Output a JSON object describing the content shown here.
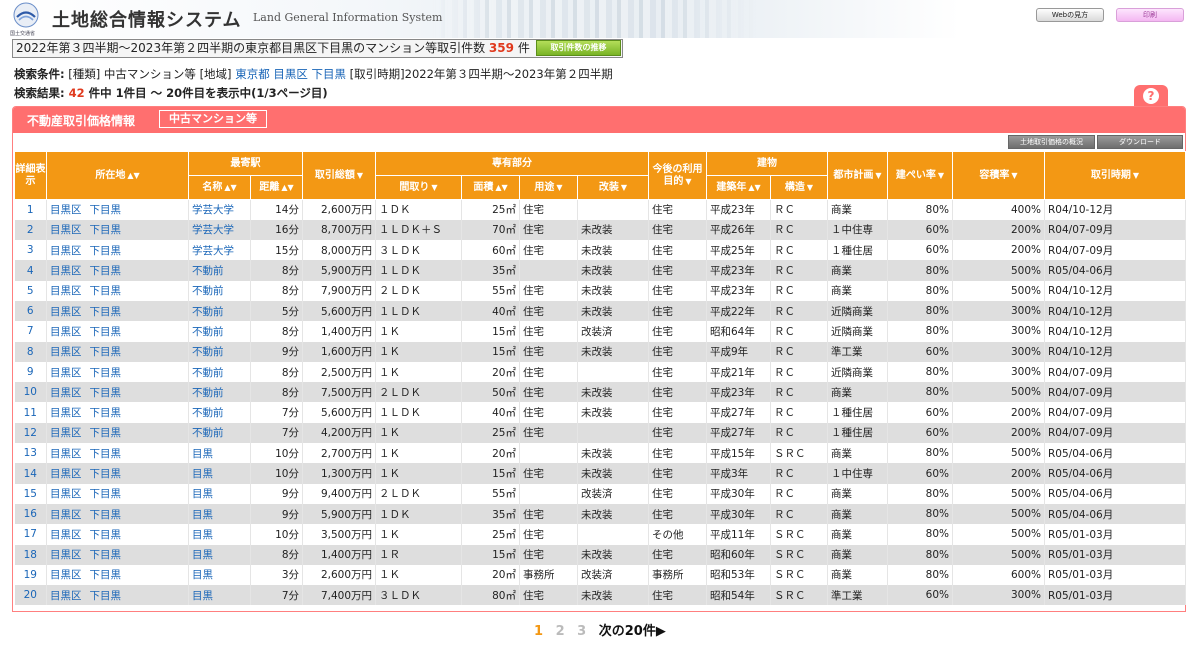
{
  "header": {
    "org": "国土交通省",
    "title": "土地総合情報システム",
    "subtitle": "Land General Information System",
    "web_btn": "Webの見方",
    "print_btn": "印刷"
  },
  "summary": {
    "prefix": "2022年第３四半期〜2023年第２四半期の東京都目黒区下目黒のマンション等取引件数",
    "count": "359",
    "suffix": "件",
    "trend_btn": "取引件数の推移"
  },
  "conditions": {
    "label": "検索条件:",
    "type_label": "[種類]",
    "type_value": "中古マンション等",
    "area_label": "[地域]",
    "pref": "東京都",
    "city": "目黒区",
    "town": "下目黒",
    "period_label": "[取引時期]",
    "period_value": "2022年第３四半期〜2023年第２四半期"
  },
  "results": {
    "label": "検索結果:",
    "count": "42",
    "text": "件中 1件目 〜 20件目を表示中(1/3ページ目)"
  },
  "panel": {
    "title": "不動産取引価格情報",
    "tag": "中古マンション等",
    "overview_btn": "土地取引価格の概況",
    "download_btn": "ダウンロード",
    "help_icon": "?"
  },
  "columns": {
    "detail": "詳細表示",
    "location": "所在地",
    "station": "最寄駅",
    "station_name": "名称",
    "distance": "距離",
    "total_price": "取引総額",
    "private_area": "専有部分",
    "layout": "間取り",
    "area": "面積",
    "use": "用途",
    "renovation": "改装",
    "future_use": "今後の利用目的",
    "building": "建物",
    "built_year": "建築年",
    "structure": "構造",
    "city_plan": "都市計画",
    "coverage": "建ぺい率",
    "floor_ratio": "容積率",
    "period": "取引時期",
    "circumstances": "取引の事情等"
  },
  "rows": [
    {
      "no": "1",
      "loc1": "目黒区",
      "loc2": "下目黒",
      "st": "学芸大学",
      "dist": "14分",
      "price": "2,600万円",
      "layout": "１ＤＫ",
      "area": "25㎡",
      "use": "住宅",
      "reno": "",
      "future": "住宅",
      "built": "平成23年",
      "struct": "ＲＣ",
      "plan": "商業",
      "cov": "80%",
      "far": "400%",
      "period": "R04/10-12月",
      "note": ""
    },
    {
      "no": "2",
      "loc1": "目黒区",
      "loc2": "下目黒",
      "st": "学芸大学",
      "dist": "16分",
      "price": "8,700万円",
      "layout": "１ＬＤＫ＋Ｓ",
      "area": "70㎡",
      "use": "住宅",
      "reno": "未改装",
      "future": "住宅",
      "built": "平成26年",
      "struct": "ＲＣ",
      "plan": "１中住専",
      "cov": "60%",
      "far": "200%",
      "period": "R04/07-09月",
      "note": ""
    },
    {
      "no": "3",
      "loc1": "目黒区",
      "loc2": "下目黒",
      "st": "学芸大学",
      "dist": "15分",
      "price": "8,000万円",
      "layout": "３ＬＤＫ",
      "area": "60㎡",
      "use": "住宅",
      "reno": "未改装",
      "future": "住宅",
      "built": "平成25年",
      "struct": "ＲＣ",
      "plan": "１種住居",
      "cov": "60%",
      "far": "200%",
      "period": "R04/07-09月",
      "note": ""
    },
    {
      "no": "4",
      "loc1": "目黒区",
      "loc2": "下目黒",
      "st": "不動前",
      "dist": "8分",
      "price": "5,900万円",
      "layout": "１ＬＤＫ",
      "area": "35㎡",
      "use": "",
      "reno": "未改装",
      "future": "住宅",
      "built": "平成23年",
      "struct": "ＲＣ",
      "plan": "商業",
      "cov": "80%",
      "far": "500%",
      "period": "R05/04-06月",
      "note": ""
    },
    {
      "no": "5",
      "loc1": "目黒区",
      "loc2": "下目黒",
      "st": "不動前",
      "dist": "8分",
      "price": "7,900万円",
      "layout": "２ＬＤＫ",
      "area": "55㎡",
      "use": "住宅",
      "reno": "未改装",
      "future": "住宅",
      "built": "平成23年",
      "struct": "ＲＣ",
      "plan": "商業",
      "cov": "80%",
      "far": "500%",
      "period": "R04/10-12月",
      "note": ""
    },
    {
      "no": "6",
      "loc1": "目黒区",
      "loc2": "下目黒",
      "st": "不動前",
      "dist": "5分",
      "price": "5,600万円",
      "layout": "１ＬＤＫ",
      "area": "40㎡",
      "use": "住宅",
      "reno": "未改装",
      "future": "住宅",
      "built": "平成22年",
      "struct": "ＲＣ",
      "plan": "近隣商業",
      "cov": "80%",
      "far": "300%",
      "period": "R04/10-12月",
      "note": ""
    },
    {
      "no": "7",
      "loc1": "目黒区",
      "loc2": "下目黒",
      "st": "不動前",
      "dist": "8分",
      "price": "1,400万円",
      "layout": "１Ｋ",
      "area": "15㎡",
      "use": "住宅",
      "reno": "改装済",
      "future": "住宅",
      "built": "昭和64年",
      "struct": "ＲＣ",
      "plan": "近隣商業",
      "cov": "80%",
      "far": "300%",
      "period": "R04/10-12月",
      "note": ""
    },
    {
      "no": "8",
      "loc1": "目黒区",
      "loc2": "下目黒",
      "st": "不動前",
      "dist": "9分",
      "price": "1,600万円",
      "layout": "１Ｋ",
      "area": "15㎡",
      "use": "住宅",
      "reno": "未改装",
      "future": "住宅",
      "built": "平成9年",
      "struct": "ＲＣ",
      "plan": "準工業",
      "cov": "60%",
      "far": "300%",
      "period": "R04/10-12月",
      "note": ""
    },
    {
      "no": "9",
      "loc1": "目黒区",
      "loc2": "下目黒",
      "st": "不動前",
      "dist": "8分",
      "price": "2,500万円",
      "layout": "１Ｋ",
      "area": "20㎡",
      "use": "住宅",
      "reno": "",
      "future": "住宅",
      "built": "平成21年",
      "struct": "ＲＣ",
      "plan": "近隣商業",
      "cov": "80%",
      "far": "300%",
      "period": "R04/07-09月",
      "note": ""
    },
    {
      "no": "10",
      "loc1": "目黒区",
      "loc2": "下目黒",
      "st": "不動前",
      "dist": "8分",
      "price": "7,500万円",
      "layout": "２ＬＤＫ",
      "area": "50㎡",
      "use": "住宅",
      "reno": "未改装",
      "future": "住宅",
      "built": "平成23年",
      "struct": "ＲＣ",
      "plan": "商業",
      "cov": "80%",
      "far": "500%",
      "period": "R04/07-09月",
      "note": ""
    },
    {
      "no": "11",
      "loc1": "目黒区",
      "loc2": "下目黒",
      "st": "不動前",
      "dist": "7分",
      "price": "5,600万円",
      "layout": "１ＬＤＫ",
      "area": "40㎡",
      "use": "住宅",
      "reno": "未改装",
      "future": "住宅",
      "built": "平成27年",
      "struct": "ＲＣ",
      "plan": "１種住居",
      "cov": "60%",
      "far": "200%",
      "period": "R04/07-09月",
      "note": ""
    },
    {
      "no": "12",
      "loc1": "目黒区",
      "loc2": "下目黒",
      "st": "不動前",
      "dist": "7分",
      "price": "4,200万円",
      "layout": "１Ｋ",
      "area": "25㎡",
      "use": "住宅",
      "reno": "",
      "future": "住宅",
      "built": "平成27年",
      "struct": "ＲＣ",
      "plan": "１種住居",
      "cov": "60%",
      "far": "200%",
      "period": "R04/07-09月",
      "note": ""
    },
    {
      "no": "13",
      "loc1": "目黒区",
      "loc2": "下目黒",
      "st": "目黒",
      "dist": "10分",
      "price": "2,700万円",
      "layout": "１Ｋ",
      "area": "20㎡",
      "use": "",
      "reno": "未改装",
      "future": "住宅",
      "built": "平成15年",
      "struct": "ＳＲＣ",
      "plan": "商業",
      "cov": "80%",
      "far": "500%",
      "period": "R05/04-06月",
      "note": ""
    },
    {
      "no": "14",
      "loc1": "目黒区",
      "loc2": "下目黒",
      "st": "目黒",
      "dist": "10分",
      "price": "1,300万円",
      "layout": "１Ｋ",
      "area": "15㎡",
      "use": "住宅",
      "reno": "未改装",
      "future": "住宅",
      "built": "平成3年",
      "struct": "ＲＣ",
      "plan": "１中住専",
      "cov": "60%",
      "far": "200%",
      "period": "R05/04-06月",
      "note": ""
    },
    {
      "no": "15",
      "loc1": "目黒区",
      "loc2": "下目黒",
      "st": "目黒",
      "dist": "9分",
      "price": "9,400万円",
      "layout": "２ＬＤＫ",
      "area": "55㎡",
      "use": "",
      "reno": "改装済",
      "future": "住宅",
      "built": "平成30年",
      "struct": "ＲＣ",
      "plan": "商業",
      "cov": "80%",
      "far": "500%",
      "period": "R05/04-06月",
      "note": ""
    },
    {
      "no": "16",
      "loc1": "目黒区",
      "loc2": "下目黒",
      "st": "目黒",
      "dist": "9分",
      "price": "5,900万円",
      "layout": "１ＤＫ",
      "area": "35㎡",
      "use": "住宅",
      "reno": "未改装",
      "future": "住宅",
      "built": "平成30年",
      "struct": "ＲＣ",
      "plan": "商業",
      "cov": "80%",
      "far": "500%",
      "period": "R05/04-06月",
      "note": ""
    },
    {
      "no": "17",
      "loc1": "目黒区",
      "loc2": "下目黒",
      "st": "目黒",
      "dist": "10分",
      "price": "3,500万円",
      "layout": "１Ｋ",
      "area": "25㎡",
      "use": "住宅",
      "reno": "",
      "future": "その他",
      "built": "平成11年",
      "struct": "ＳＲＣ",
      "plan": "商業",
      "cov": "80%",
      "far": "500%",
      "period": "R05/01-03月",
      "note": ""
    },
    {
      "no": "18",
      "loc1": "目黒区",
      "loc2": "下目黒",
      "st": "目黒",
      "dist": "8分",
      "price": "1,400万円",
      "layout": "１Ｒ",
      "area": "15㎡",
      "use": "住宅",
      "reno": "未改装",
      "future": "住宅",
      "built": "昭和60年",
      "struct": "ＳＲＣ",
      "plan": "商業",
      "cov": "80%",
      "far": "500%",
      "period": "R05/01-03月",
      "note": ""
    },
    {
      "no": "19",
      "loc1": "目黒区",
      "loc2": "下目黒",
      "st": "目黒",
      "dist": "3分",
      "price": "2,600万円",
      "layout": "１Ｋ",
      "area": "20㎡",
      "use": "事務所",
      "reno": "改装済",
      "future": "事務所",
      "built": "昭和53年",
      "struct": "ＳＲＣ",
      "plan": "商業",
      "cov": "80%",
      "far": "600%",
      "period": "R05/01-03月",
      "note": ""
    },
    {
      "no": "20",
      "loc1": "目黒区",
      "loc2": "下目黒",
      "st": "目黒",
      "dist": "7分",
      "price": "7,400万円",
      "layout": "３ＬＤＫ",
      "area": "80㎡",
      "use": "住宅",
      "reno": "未改装",
      "future": "住宅",
      "built": "昭和54年",
      "struct": "ＳＲＣ",
      "plan": "準工業",
      "cov": "60%",
      "far": "300%",
      "period": "R05/01-03月",
      "note": ""
    }
  ],
  "pager": {
    "current": "1",
    "page2": "2",
    "page3": "3",
    "next": "次の20件▶"
  },
  "colors": {
    "accent_header": "#f39814",
    "panel": "#ff6f6f",
    "highlight": "#e03a1e",
    "link": "#1a66b8"
  }
}
